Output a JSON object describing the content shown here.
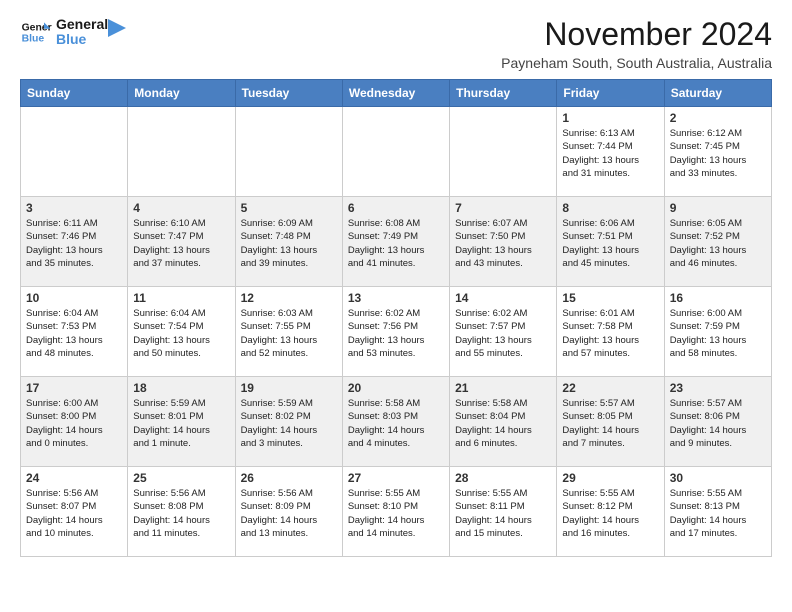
{
  "header": {
    "logo_line1": "General",
    "logo_line2": "Blue",
    "month": "November 2024",
    "location": "Payneham South, South Australia, Australia"
  },
  "weekdays": [
    "Sunday",
    "Monday",
    "Tuesday",
    "Wednesday",
    "Thursday",
    "Friday",
    "Saturday"
  ],
  "weeks": [
    [
      {
        "day": "",
        "info": ""
      },
      {
        "day": "",
        "info": ""
      },
      {
        "day": "",
        "info": ""
      },
      {
        "day": "",
        "info": ""
      },
      {
        "day": "",
        "info": ""
      },
      {
        "day": "1",
        "info": "Sunrise: 6:13 AM\nSunset: 7:44 PM\nDaylight: 13 hours\nand 31 minutes."
      },
      {
        "day": "2",
        "info": "Sunrise: 6:12 AM\nSunset: 7:45 PM\nDaylight: 13 hours\nand 33 minutes."
      }
    ],
    [
      {
        "day": "3",
        "info": "Sunrise: 6:11 AM\nSunset: 7:46 PM\nDaylight: 13 hours\nand 35 minutes."
      },
      {
        "day": "4",
        "info": "Sunrise: 6:10 AM\nSunset: 7:47 PM\nDaylight: 13 hours\nand 37 minutes."
      },
      {
        "day": "5",
        "info": "Sunrise: 6:09 AM\nSunset: 7:48 PM\nDaylight: 13 hours\nand 39 minutes."
      },
      {
        "day": "6",
        "info": "Sunrise: 6:08 AM\nSunset: 7:49 PM\nDaylight: 13 hours\nand 41 minutes."
      },
      {
        "day": "7",
        "info": "Sunrise: 6:07 AM\nSunset: 7:50 PM\nDaylight: 13 hours\nand 43 minutes."
      },
      {
        "day": "8",
        "info": "Sunrise: 6:06 AM\nSunset: 7:51 PM\nDaylight: 13 hours\nand 45 minutes."
      },
      {
        "day": "9",
        "info": "Sunrise: 6:05 AM\nSunset: 7:52 PM\nDaylight: 13 hours\nand 46 minutes."
      }
    ],
    [
      {
        "day": "10",
        "info": "Sunrise: 6:04 AM\nSunset: 7:53 PM\nDaylight: 13 hours\nand 48 minutes."
      },
      {
        "day": "11",
        "info": "Sunrise: 6:04 AM\nSunset: 7:54 PM\nDaylight: 13 hours\nand 50 minutes."
      },
      {
        "day": "12",
        "info": "Sunrise: 6:03 AM\nSunset: 7:55 PM\nDaylight: 13 hours\nand 52 minutes."
      },
      {
        "day": "13",
        "info": "Sunrise: 6:02 AM\nSunset: 7:56 PM\nDaylight: 13 hours\nand 53 minutes."
      },
      {
        "day": "14",
        "info": "Sunrise: 6:02 AM\nSunset: 7:57 PM\nDaylight: 13 hours\nand 55 minutes."
      },
      {
        "day": "15",
        "info": "Sunrise: 6:01 AM\nSunset: 7:58 PM\nDaylight: 13 hours\nand 57 minutes."
      },
      {
        "day": "16",
        "info": "Sunrise: 6:00 AM\nSunset: 7:59 PM\nDaylight: 13 hours\nand 58 minutes."
      }
    ],
    [
      {
        "day": "17",
        "info": "Sunrise: 6:00 AM\nSunset: 8:00 PM\nDaylight: 14 hours\nand 0 minutes."
      },
      {
        "day": "18",
        "info": "Sunrise: 5:59 AM\nSunset: 8:01 PM\nDaylight: 14 hours\nand 1 minute."
      },
      {
        "day": "19",
        "info": "Sunrise: 5:59 AM\nSunset: 8:02 PM\nDaylight: 14 hours\nand 3 minutes."
      },
      {
        "day": "20",
        "info": "Sunrise: 5:58 AM\nSunset: 8:03 PM\nDaylight: 14 hours\nand 4 minutes."
      },
      {
        "day": "21",
        "info": "Sunrise: 5:58 AM\nSunset: 8:04 PM\nDaylight: 14 hours\nand 6 minutes."
      },
      {
        "day": "22",
        "info": "Sunrise: 5:57 AM\nSunset: 8:05 PM\nDaylight: 14 hours\nand 7 minutes."
      },
      {
        "day": "23",
        "info": "Sunrise: 5:57 AM\nSunset: 8:06 PM\nDaylight: 14 hours\nand 9 minutes."
      }
    ],
    [
      {
        "day": "24",
        "info": "Sunrise: 5:56 AM\nSunset: 8:07 PM\nDaylight: 14 hours\nand 10 minutes."
      },
      {
        "day": "25",
        "info": "Sunrise: 5:56 AM\nSunset: 8:08 PM\nDaylight: 14 hours\nand 11 minutes."
      },
      {
        "day": "26",
        "info": "Sunrise: 5:56 AM\nSunset: 8:09 PM\nDaylight: 14 hours\nand 13 minutes."
      },
      {
        "day": "27",
        "info": "Sunrise: 5:55 AM\nSunset: 8:10 PM\nDaylight: 14 hours\nand 14 minutes."
      },
      {
        "day": "28",
        "info": "Sunrise: 5:55 AM\nSunset: 8:11 PM\nDaylight: 14 hours\nand 15 minutes."
      },
      {
        "day": "29",
        "info": "Sunrise: 5:55 AM\nSunset: 8:12 PM\nDaylight: 14 hours\nand 16 minutes."
      },
      {
        "day": "30",
        "info": "Sunrise: 5:55 AM\nSunset: 8:13 PM\nDaylight: 14 hours\nand 17 minutes."
      }
    ]
  ]
}
